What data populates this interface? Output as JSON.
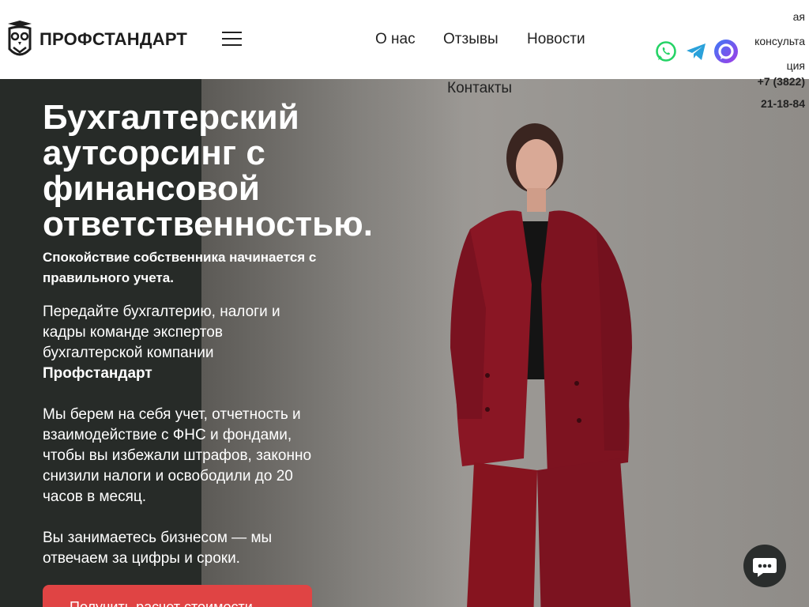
{
  "header": {
    "logo_text": "ПРОФСТАНДАРТ",
    "nav": {
      "about": "О нас",
      "reviews": "Отзывы",
      "news": "Новости",
      "contacts": "Контакты"
    },
    "consult_lines": [
      "ая",
      "консульта",
      "ция"
    ],
    "phone_lines": [
      "+7 (3822)",
      "21-18-84"
    ],
    "icons": {
      "whatsapp": "whatsapp-icon",
      "telegram": "telegram-icon",
      "max": "max-messenger-icon",
      "menu": "hamburger-icon"
    }
  },
  "hero": {
    "title": "Бухгалтерский аутсорсинг с финансовой ответственностью.",
    "subtitle": "Спокойствие собственника начинается с правильного учета.",
    "p1_text": "Передайте бухгалтерию, налоги и кадры команде экспертов бухгалтерской компании ",
    "p1_bold": "Профстандарт",
    "p2": "Мы берем на себя учет, отчетность и взаимодействие с ФНС и фондами, чтобы вы избежали штрафов, законно снизили налоги и освободили до 20 часов в месяц.",
    "p3": "Вы занимаетесь бизнесом — мы отвечаем за цифры и сроки.",
    "cta_label": "Получить расчет стоимости  →"
  },
  "colors": {
    "accent": "#e04444",
    "dark_panel": "#272b28",
    "suit": "#8a1624",
    "whatsapp": "#25d366",
    "telegram": "#2aa1da"
  }
}
